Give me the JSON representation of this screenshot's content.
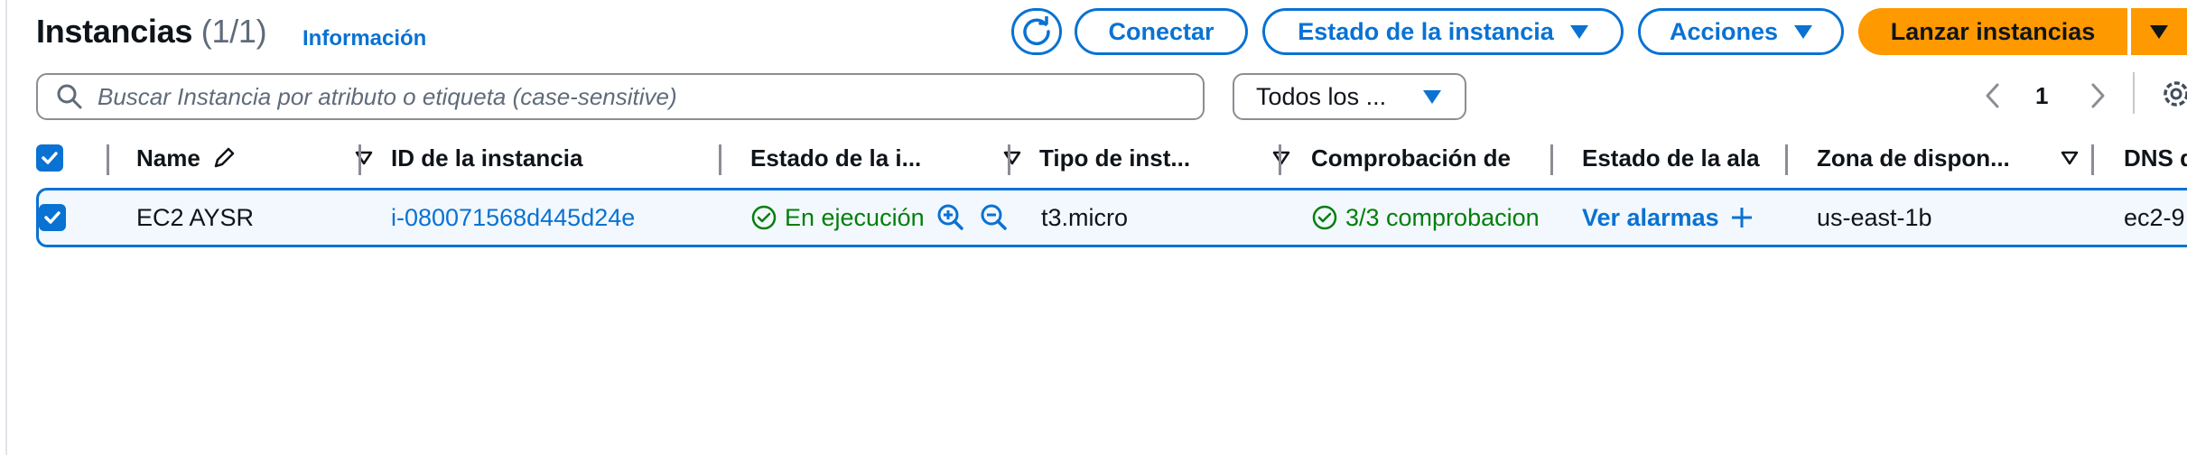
{
  "header": {
    "title": "Instancias",
    "count": "(1/1)",
    "info_link": "Información",
    "connect_label": "Conectar",
    "instance_state_label": "Estado de la instancia",
    "actions_label": "Acciones",
    "launch_label": "Lanzar instancias"
  },
  "search": {
    "placeholder": "Buscar Instancia por atributo o etiqueta (case-sensitive)"
  },
  "filter": {
    "selected": "Todos los ..."
  },
  "pagination": {
    "current_page": "1"
  },
  "table": {
    "columns": [
      "Name",
      "ID de la instancia",
      "Estado de la i...",
      "Tipo de inst...",
      "Comprobación de",
      "Estado de la ala",
      "Zona de dispon...",
      "DNS d"
    ],
    "rows": [
      {
        "name": "EC2 AYSR",
        "instance_id": "i-080071568d445d24e",
        "state": "En ejecución",
        "type": "t3.micro",
        "status_check": "3/3 comprobacion",
        "alarm": "Ver alarmas",
        "zone": "us-east-1b",
        "dns": "ec2-9"
      }
    ]
  },
  "colors": {
    "accent": "#0972d3",
    "launch": "#ff9900",
    "success": "#037f0c"
  }
}
